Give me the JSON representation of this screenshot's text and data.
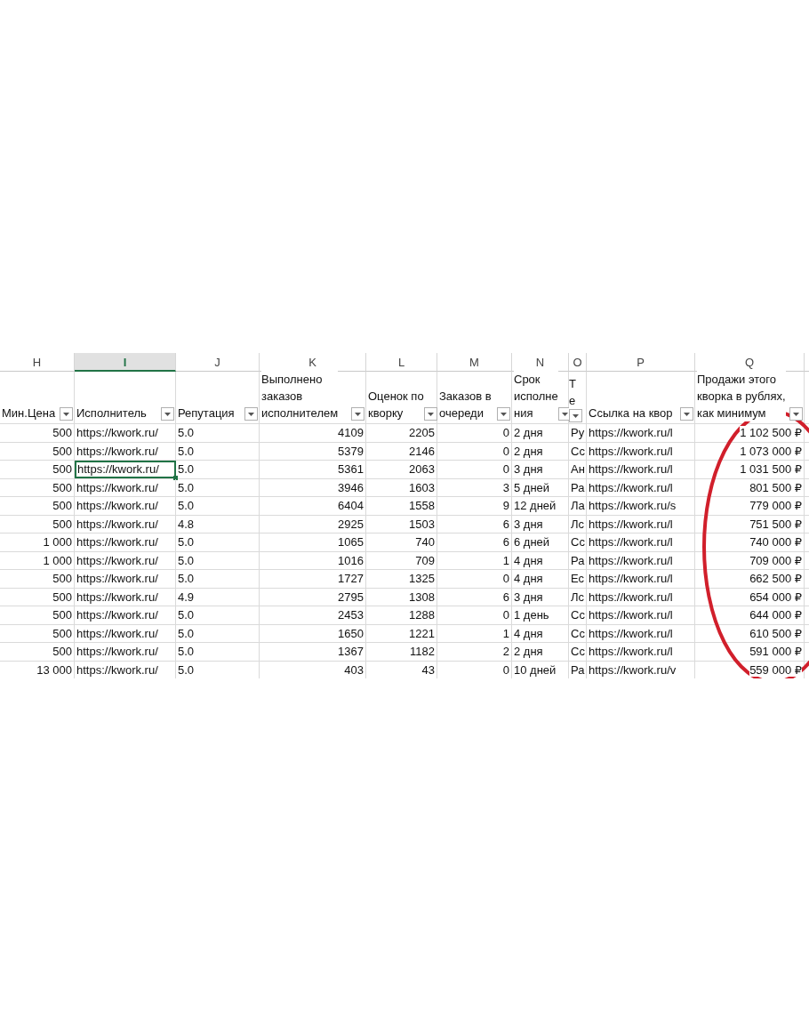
{
  "sheet": {
    "columns": [
      {
        "letter": "H",
        "label": [
          "Мин.Цена"
        ],
        "selected": false
      },
      {
        "letter": "I",
        "label": [
          "Исполнитель"
        ],
        "selected": true
      },
      {
        "letter": "J",
        "label": [
          "Репутация"
        ],
        "selected": false
      },
      {
        "letter": "K",
        "label": [
          "Выполнено",
          "заказов",
          "исполнителем"
        ],
        "selected": false
      },
      {
        "letter": "L",
        "label": [
          "Оценок по",
          "кворку"
        ],
        "selected": false
      },
      {
        "letter": "M",
        "label": [
          "Заказов в",
          "очереди"
        ],
        "selected": false
      },
      {
        "letter": "N",
        "label": [
          "Срок",
          "исполне",
          "ния"
        ],
        "selected": false
      },
      {
        "letter": "O",
        "label": [
          "Т",
          "е"
        ],
        "selected": false
      },
      {
        "letter": "P",
        "label": [
          "Ссылка на квор"
        ],
        "selected": false
      },
      {
        "letter": "Q",
        "label": [
          "Продажи этого",
          "кворка в рублях,",
          "как минимум"
        ],
        "selected": false
      }
    ],
    "rows": [
      {
        "selected": false,
        "cells": [
          "500",
          "https://kwork.ru/",
          "5.0",
          "4109",
          "2205",
          "0",
          "2 дня",
          "Ру",
          "https://kwork.ru/l",
          "1 102 500 ₽"
        ]
      },
      {
        "selected": false,
        "cells": [
          "500",
          "https://kwork.ru/",
          "5.0",
          "5379",
          "2146",
          "0",
          "2 дня",
          "Сс",
          "https://kwork.ru/l",
          "1 073 000 ₽"
        ]
      },
      {
        "selected": true,
        "cells": [
          "500",
          "https://kwork.ru/",
          "5.0",
          "5361",
          "2063",
          "0",
          "3 дня",
          "Ан",
          "https://kwork.ru/l",
          "1 031 500 ₽"
        ]
      },
      {
        "selected": false,
        "cells": [
          "500",
          "https://kwork.ru/",
          "5.0",
          "3946",
          "1603",
          "3",
          "5 дней",
          "Ра",
          "https://kwork.ru/l",
          "801 500 ₽"
        ]
      },
      {
        "selected": false,
        "cells": [
          "500",
          "https://kwork.ru/",
          "5.0",
          "6404",
          "1558",
          "9",
          "12 дней",
          "Ла",
          "https://kwork.ru/s",
          "779 000 ₽"
        ]
      },
      {
        "selected": false,
        "cells": [
          "500",
          "https://kwork.ru/",
          "4.8",
          "2925",
          "1503",
          "6",
          "3 дня",
          "Лс",
          "https://kwork.ru/l",
          "751 500 ₽"
        ]
      },
      {
        "selected": false,
        "cells": [
          "1 000",
          "https://kwork.ru/",
          "5.0",
          "1065",
          "740",
          "6",
          "6 дней",
          "Сс",
          "https://kwork.ru/l",
          "740 000 ₽"
        ]
      },
      {
        "selected": false,
        "cells": [
          "1 000",
          "https://kwork.ru/",
          "5.0",
          "1016",
          "709",
          "1",
          "4 дня",
          "Ра",
          "https://kwork.ru/l",
          "709 000 ₽"
        ]
      },
      {
        "selected": false,
        "cells": [
          "500",
          "https://kwork.ru/",
          "5.0",
          "1727",
          "1325",
          "0",
          "4 дня",
          "Ес",
          "https://kwork.ru/l",
          "662 500 ₽"
        ]
      },
      {
        "selected": false,
        "cells": [
          "500",
          "https://kwork.ru/",
          "4.9",
          "2795",
          "1308",
          "6",
          "3 дня",
          "Лс",
          "https://kwork.ru/l",
          "654 000 ₽"
        ]
      },
      {
        "selected": false,
        "cells": [
          "500",
          "https://kwork.ru/",
          "5.0",
          "2453",
          "1288",
          "0",
          "1 день",
          "Сс",
          "https://kwork.ru/l",
          "644 000 ₽"
        ]
      },
      {
        "selected": false,
        "cells": [
          "500",
          "https://kwork.ru/",
          "5.0",
          "1650",
          "1221",
          "1",
          "4 дня",
          "Сс",
          "https://kwork.ru/l",
          "610 500 ₽"
        ]
      },
      {
        "selected": false,
        "cells": [
          "500",
          "https://kwork.ru/",
          "5.0",
          "1367",
          "1182",
          "2",
          "2 дня",
          "Сс",
          "https://kwork.ru/l",
          "591 000 ₽"
        ]
      },
      {
        "selected": false,
        "cells": [
          "13 000",
          "https://kwork.ru/",
          "5.0",
          "403",
          "43",
          "0",
          "10 дней",
          "Ра",
          "https://kwork.ru/v",
          "559 000 ₽"
        ]
      }
    ]
  }
}
